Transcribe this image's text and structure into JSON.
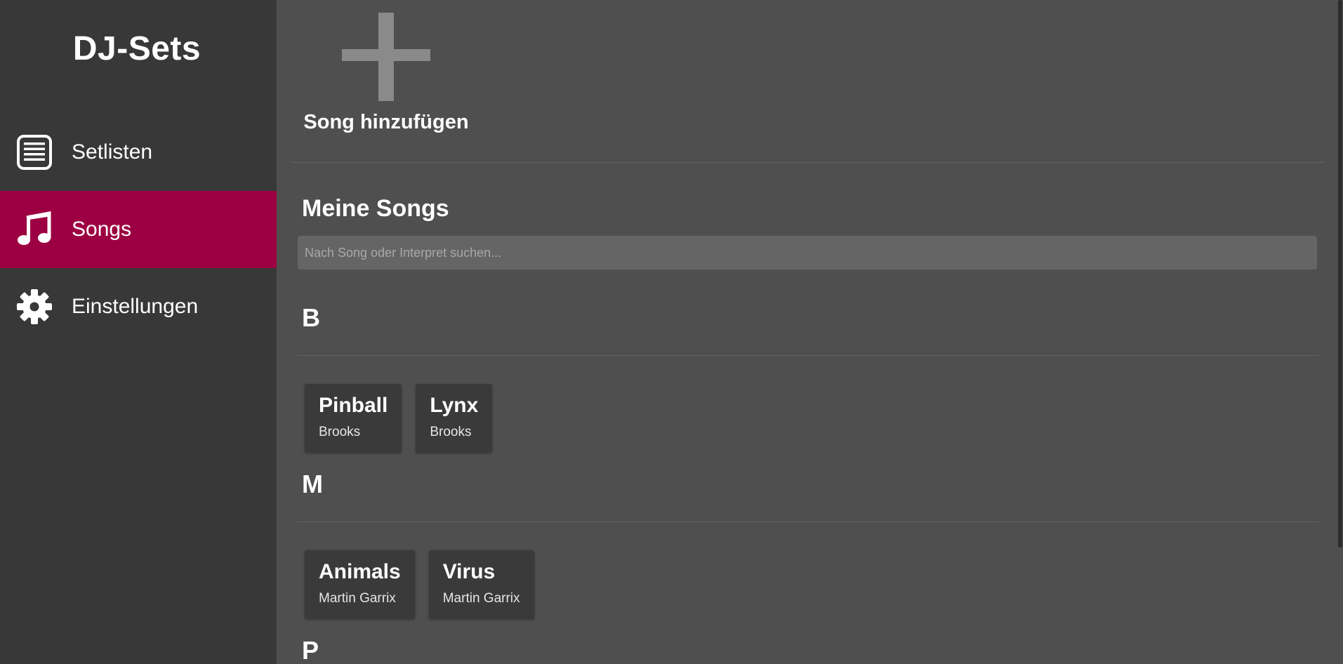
{
  "sidebar": {
    "brand": "DJ-Sets",
    "items": [
      {
        "label": "Setlisten",
        "icon": "list-icon",
        "active": false
      },
      {
        "label": "Songs",
        "icon": "music-note-icon",
        "active": true
      },
      {
        "label": "Einstellungen",
        "icon": "gear-icon",
        "active": false
      }
    ],
    "active_color": "#9c0042"
  },
  "main": {
    "add_song_label": "Song hinzufügen",
    "add_icon": "plus-icon",
    "section_title": "Meine Songs",
    "search": {
      "value": "",
      "placeholder": "Nach Song oder Interpret suchen..."
    },
    "groups": [
      {
        "letter": "B",
        "songs": [
          {
            "title": "Pinball",
            "artist": "Brooks"
          },
          {
            "title": "Lynx",
            "artist": "Brooks"
          }
        ]
      },
      {
        "letter": "M",
        "songs": [
          {
            "title": "Animals",
            "artist": "Martin Garrix"
          },
          {
            "title": "Virus",
            "artist": "Martin Garrix"
          }
        ]
      },
      {
        "letter": "P",
        "songs": []
      }
    ]
  }
}
